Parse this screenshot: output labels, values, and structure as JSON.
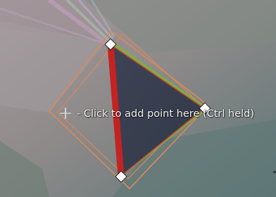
{
  "canvas": {
    "add_point_hint": "- Click to add point here (Ctrl held)",
    "cursor_icon": "crosshair-icon",
    "handle_icon": "diamond-handle-icon"
  },
  "colors": {
    "selected_edge": "#c52222",
    "triangle_fill": "#3a3f4f",
    "selection_frame": "#d98a5a",
    "edge_highlight": "#7fb33a",
    "handle_fill": "#ffffff",
    "handle_stroke": "#222222"
  }
}
